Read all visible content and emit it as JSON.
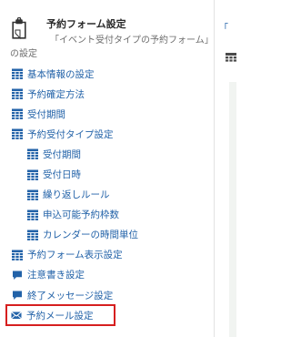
{
  "header": {
    "icon": "clipboard-icon",
    "title": "予約フォーム設定",
    "description": "「イベント受付タイプの予約フォーム」の設定"
  },
  "nav": [
    {
      "label": "基本情報の設定",
      "icon": "calendar-icon",
      "level": 1
    },
    {
      "label": "予約確定方法",
      "icon": "calendar-icon",
      "level": 1
    },
    {
      "label": "受付期間",
      "icon": "calendar-icon",
      "level": 1
    },
    {
      "label": "予約受付タイプ設定",
      "icon": "calendar-icon",
      "level": 1
    },
    {
      "label": "受付期間",
      "icon": "calendar-icon",
      "level": 2
    },
    {
      "label": "受付日時",
      "icon": "calendar-icon",
      "level": 2
    },
    {
      "label": "繰り返しルール",
      "icon": "calendar-icon",
      "level": 2
    },
    {
      "label": "申込可能予約枠数",
      "icon": "calendar-icon",
      "level": 2
    },
    {
      "label": "カレンダーの時間単位",
      "icon": "calendar-icon",
      "level": 2
    },
    {
      "label": "予約フォーム表示設定",
      "icon": "calendar-icon",
      "level": 1
    },
    {
      "label": "注意書き設定",
      "icon": "comment-icon",
      "level": 1
    },
    {
      "label": "終了メッセージ設定",
      "icon": "comment-icon",
      "level": 1
    },
    {
      "label": "予約メール設定",
      "icon": "envelope-icon",
      "level": 1,
      "highlighted": true
    }
  ],
  "right_panel": {
    "mark": "「",
    "icon": "calendar-icon"
  },
  "colors": {
    "link": "#2262a8",
    "title": "#2b2b2b",
    "description": "#6e6e6e",
    "highlight_border": "#d61f1f"
  }
}
